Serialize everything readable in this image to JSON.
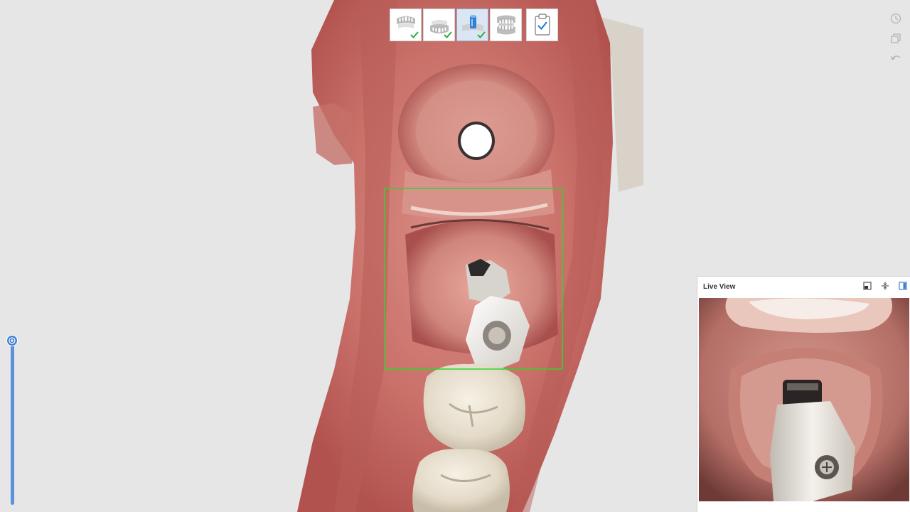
{
  "live_view": {
    "title": "Live View",
    "controls": [
      "picture-in-picture-icon",
      "fit-view-icon",
      "side-panel-icon"
    ]
  },
  "stage_toolbar": {
    "stages": [
      {
        "icon": "upper-jaw-icon",
        "completed": true,
        "active": false
      },
      {
        "icon": "lower-jaw-icon",
        "completed": true,
        "active": false
      },
      {
        "icon": "scanbody-icon",
        "completed": true,
        "active": true
      },
      {
        "icon": "bite-icon",
        "completed": false,
        "active": false
      },
      {
        "icon": "review-clipboard-icon",
        "completed": false,
        "active": false
      }
    ]
  },
  "side_tools": [
    "history-icon",
    "copy-icon",
    "undo-icon"
  ],
  "slider": {
    "value": 1.0,
    "icon": "camera-aperture-icon"
  },
  "scan_region": {
    "highlight_color": "#32d42a"
  },
  "colors": {
    "accent": "#3f7fd1",
    "check": "#2fae3f",
    "gum": "#cf7f78",
    "tooth": "#ece6da"
  }
}
